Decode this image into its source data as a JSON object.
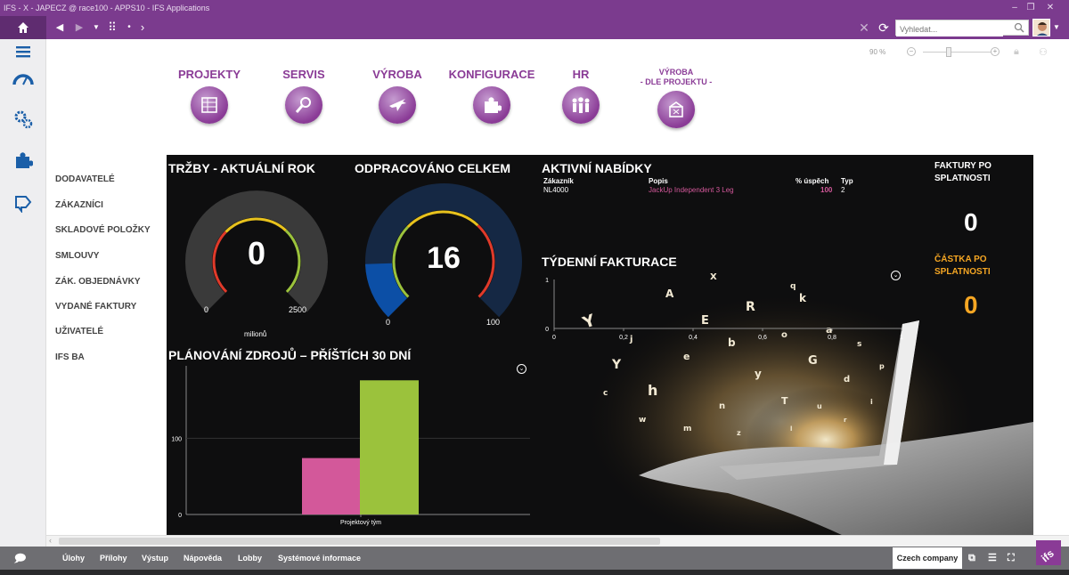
{
  "window": {
    "title": "IFS - X - JAPECZ @ race100 - APPS10 - IFS Applications"
  },
  "toolbar": {
    "search_placeholder": "Vyhledat..."
  },
  "zoom": {
    "level": "90 %"
  },
  "modules": [
    {
      "label": "PROJEKTY",
      "icon": "projects-icon"
    },
    {
      "label": "SERVIS",
      "icon": "service-icon"
    },
    {
      "label": "VÝROBA",
      "icon": "airplane-icon"
    },
    {
      "label": "KONFIGURACE",
      "icon": "puzzle-icon"
    },
    {
      "label": "HR",
      "icon": "people-icon"
    },
    {
      "label": "VÝROBA",
      "label2": "- DLE PROJEKTU -",
      "icon": "factory-icon"
    }
  ],
  "links": [
    "DODAVATELÉ",
    "ZÁKAZNÍCI",
    "SKLADOVÉ POLOŽKY",
    "SMLOUVY",
    "ZÁK. OBJEDNÁVKY",
    "VYDANÉ FAKTURY",
    "UŽIVATELÉ",
    "IFS BA"
  ],
  "dashboard": {
    "sales": {
      "title": "TRŽBY - AKTUÁLNÍ ROK",
      "value": "0",
      "min": "0",
      "max": "2500",
      "unit": "milionů",
      "level": 0
    },
    "worked": {
      "title": "ODPRACOVÁNO CELKEM",
      "value": "16",
      "min": "0",
      "max": "100",
      "level": 0.16
    },
    "offers": {
      "title": "AKTIVNÍ NABÍDKY",
      "headers": [
        "Zákazník",
        "Popis",
        "% úspěch",
        "Typ"
      ],
      "rows": [
        {
          "customer": "NL4000",
          "desc": "JackUp Independent 3 Leg",
          "success": "100",
          "type": "2"
        }
      ]
    },
    "weekly": {
      "title": "TÝDENNÍ FAKTURACE"
    },
    "due_invoices": {
      "title1": "FAKTURY PO",
      "title2": "SPLATNOSTI",
      "value": "0"
    },
    "due_amount": {
      "title1": "ČÁSTKA PO",
      "title2": "SPLATNOSTI",
      "value": "0"
    },
    "planning": {
      "title": "PLÁNOVÁNÍ ZDROJŮ – PŘÍŠTÍCH 30 DNÍ"
    }
  },
  "colors": {
    "brand": "#7b3b8e",
    "accent_orange": "#f5a623",
    "pink": "#d3589a",
    "green": "#9bc23c"
  },
  "chart_data": [
    {
      "type": "scatter",
      "title": "TÝDENNÍ FAKTURACE",
      "x": [],
      "y": [],
      "xlim": [
        0,
        1
      ],
      "ylim": [
        0,
        1
      ],
      "xticks": [
        "0",
        "0,2",
        "0,4",
        "0,6",
        "0,8",
        "1"
      ],
      "yticks": [
        "0",
        "1"
      ]
    },
    {
      "type": "bar",
      "title": "PLÁNOVÁNÍ ZDROJŮ – PŘÍŠTÍCH 30 DNÍ",
      "categories": [
        "Projektový tým"
      ],
      "series": [
        {
          "values": [
            74
          ],
          "color": "#d3589a"
        },
        {
          "values": [
            176
          ],
          "color": "#9bc23c"
        }
      ],
      "ylim": [
        0,
        195
      ],
      "yticks": [
        "0",
        "100"
      ]
    }
  ],
  "statusbar": {
    "items": [
      "Úlohy",
      "Přílohy",
      "Výstup",
      "Nápověda",
      "Lobby",
      "Systémové informace"
    ],
    "company": "Czech company"
  }
}
